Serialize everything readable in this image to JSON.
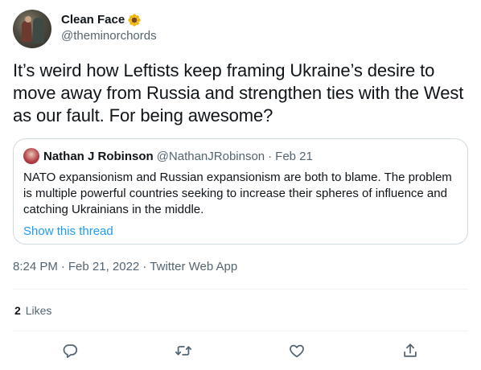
{
  "author": {
    "display_name": "Clean Face",
    "emoji": "sunflower-icon",
    "handle": "@theminorchords"
  },
  "tweet": {
    "text": "It’s weird how Leftists keep framing Ukraine’s desire to move away from Russia and strengthen ties with the West as our fault.  For being awesome?"
  },
  "quoted": {
    "name": "Nathan J Robinson",
    "handle": "@NathanJRobinson",
    "separator": "·",
    "date": "Feb 21",
    "text": "NATO expansionism and Russian expansionism are both to blame. The problem is multiple powerful countries seeking to increase their spheres of influence and catching Ukrainians in the middle.",
    "show_thread": "Show this thread"
  },
  "meta": {
    "time": "8:24 PM",
    "date": "Feb 21, 2022",
    "source": "Twitter Web App",
    "separator": "·"
  },
  "stats": {
    "likes_count": "2",
    "likes_label": "Likes"
  },
  "actions": {
    "reply": "reply-icon",
    "retweet": "retweet-icon",
    "like": "heart-icon",
    "share": "share-icon"
  },
  "colors": {
    "text": "#0f1419",
    "secondary": "#536471",
    "link": "#1d9bf0",
    "border": "#cfd9de"
  }
}
